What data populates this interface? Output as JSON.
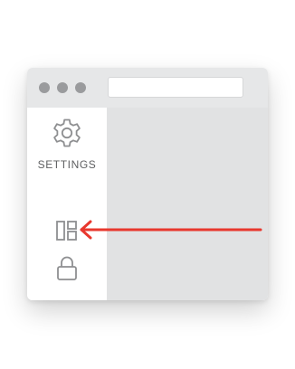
{
  "window": {
    "window_controls": [
      "close",
      "minimize",
      "maximize"
    ],
    "address_bar": ""
  },
  "sidebar": {
    "items": [
      {
        "icon": "gear-icon",
        "label": "SETTINGS"
      },
      {
        "icon": "layout-icon",
        "label": ""
      },
      {
        "icon": "lock-icon",
        "label": ""
      }
    ]
  },
  "annotation": {
    "type": "arrow",
    "points_to": "layout-icon",
    "color": "#e8382e"
  },
  "colors": {
    "titlebar": "#e6e7e8",
    "content": "#e1e2e3",
    "icon_stroke": "#8e8f91",
    "accent_arrow": "#e8382e"
  }
}
